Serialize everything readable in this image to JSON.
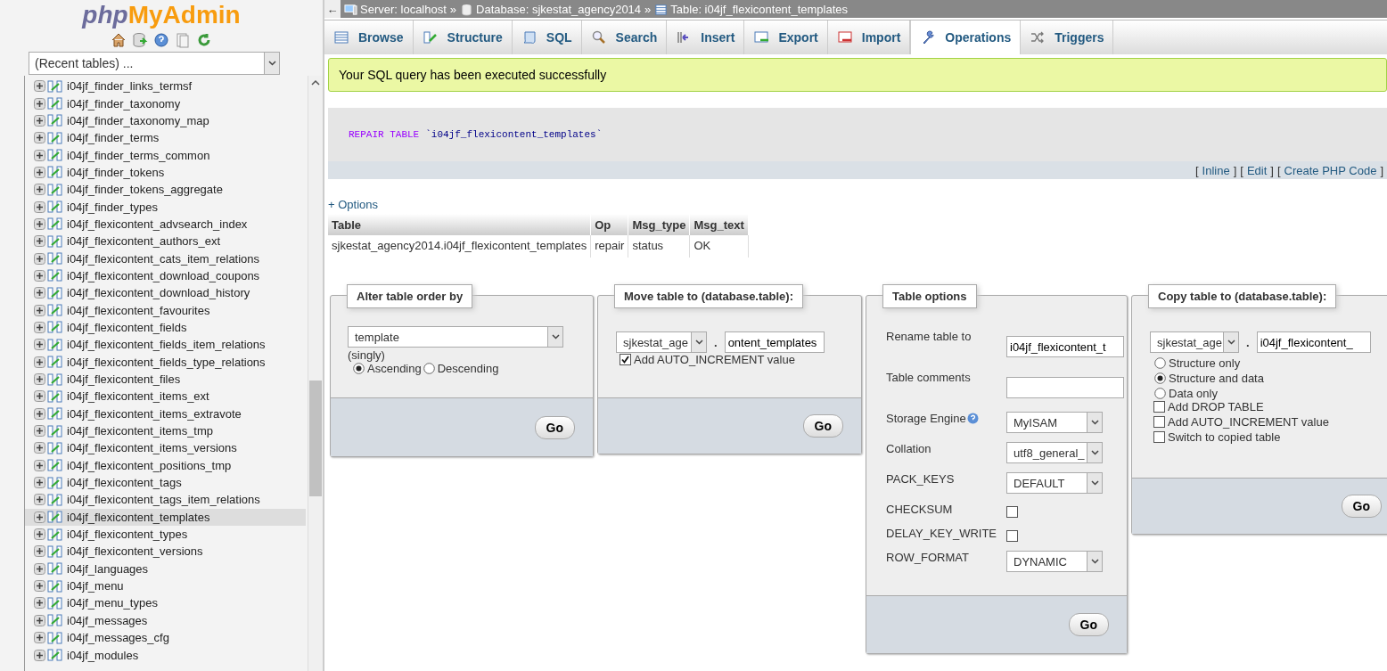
{
  "sidebar": {
    "logo": {
      "prefix": "php",
      "brand": "MyAdmin"
    },
    "recent_select": "(Recent tables) ...",
    "tables": [
      {
        "name": "i04jf_finder_links_termsf",
        "selected": false
      },
      {
        "name": "i04jf_finder_taxonomy",
        "selected": false
      },
      {
        "name": "i04jf_finder_taxonomy_map",
        "selected": false
      },
      {
        "name": "i04jf_finder_terms",
        "selected": false
      },
      {
        "name": "i04jf_finder_terms_common",
        "selected": false
      },
      {
        "name": "i04jf_finder_tokens",
        "selected": false
      },
      {
        "name": "i04jf_finder_tokens_aggregate",
        "selected": false
      },
      {
        "name": "i04jf_finder_types",
        "selected": false
      },
      {
        "name": "i04jf_flexicontent_advsearch_index",
        "selected": false
      },
      {
        "name": "i04jf_flexicontent_authors_ext",
        "selected": false
      },
      {
        "name": "i04jf_flexicontent_cats_item_relations",
        "selected": false
      },
      {
        "name": "i04jf_flexicontent_download_coupons",
        "selected": false
      },
      {
        "name": "i04jf_flexicontent_download_history",
        "selected": false
      },
      {
        "name": "i04jf_flexicontent_favourites",
        "selected": false
      },
      {
        "name": "i04jf_flexicontent_fields",
        "selected": false
      },
      {
        "name": "i04jf_flexicontent_fields_item_relations",
        "selected": false
      },
      {
        "name": "i04jf_flexicontent_fields_type_relations",
        "selected": false
      },
      {
        "name": "i04jf_flexicontent_files",
        "selected": false
      },
      {
        "name": "i04jf_flexicontent_items_ext",
        "selected": false
      },
      {
        "name": "i04jf_flexicontent_items_extravote",
        "selected": false
      },
      {
        "name": "i04jf_flexicontent_items_tmp",
        "selected": false
      },
      {
        "name": "i04jf_flexicontent_items_versions",
        "selected": false
      },
      {
        "name": "i04jf_flexicontent_positions_tmp",
        "selected": false
      },
      {
        "name": "i04jf_flexicontent_tags",
        "selected": false
      },
      {
        "name": "i04jf_flexicontent_tags_item_relations",
        "selected": false
      },
      {
        "name": "i04jf_flexicontent_templates",
        "selected": true
      },
      {
        "name": "i04jf_flexicontent_types",
        "selected": false
      },
      {
        "name": "i04jf_flexicontent_versions",
        "selected": false
      },
      {
        "name": "i04jf_languages",
        "selected": false
      },
      {
        "name": "i04jf_menu",
        "selected": false
      },
      {
        "name": "i04jf_menu_types",
        "selected": false
      },
      {
        "name": "i04jf_messages",
        "selected": false
      },
      {
        "name": "i04jf_messages_cfg",
        "selected": false
      },
      {
        "name": "i04jf_modules",
        "selected": false
      }
    ]
  },
  "breadcrumb": {
    "back": "←",
    "items": [
      {
        "kind": "server",
        "text": "Server: localhost",
        "separator": "»"
      },
      {
        "kind": "database",
        "text": "Database: sjkestat_agency2014",
        "separator": "»"
      },
      {
        "kind": "table",
        "text": "Table: i04jf_flexicontent_templates"
      }
    ]
  },
  "tabs": [
    {
      "label": "Browse",
      "selected": false
    },
    {
      "label": "Structure",
      "selected": false
    },
    {
      "label": "SQL",
      "selected": false
    },
    {
      "label": "Search",
      "selected": false
    },
    {
      "label": "Insert",
      "selected": false
    },
    {
      "label": "Export",
      "selected": false
    },
    {
      "label": "Import",
      "selected": false
    },
    {
      "label": "Operations",
      "selected": true
    },
    {
      "label": "Triggers",
      "selected": false
    }
  ],
  "message": "Your SQL query has been executed successfully",
  "sql": {
    "keyword": "REPAIR TABLE",
    "identifier": "`i04jf_flexicontent_templates`",
    "link_open": "[",
    "link_close": "]",
    "links": [
      "Inline",
      "Edit",
      "Create PHP Code"
    ]
  },
  "options_toggle": "+ Options",
  "result_table": {
    "columns": [
      "Table",
      "Op",
      "Msg_type",
      "Msg_text"
    ],
    "rows": [
      [
        "sjkestat_agency2014.i04jf_flexicontent_templates",
        "repair",
        "status",
        "OK"
      ]
    ]
  },
  "panels": [
    {
      "kind": "order",
      "legend": "Alter table order by",
      "select": "template",
      "note": "(singly)",
      "radios": [
        {
          "label": "Ascending",
          "selected": true
        },
        {
          "label": "Descending",
          "selected": false
        }
      ],
      "button": "Go"
    },
    {
      "kind": "move",
      "legend": "Move table to (database.table):",
      "db_select": "sjkestat_age",
      "dot": ".",
      "table_input": "ontent_templates",
      "checkboxes": [
        {
          "label": "Add AUTO_INCREMENT value",
          "checked": true
        }
      ],
      "button": "Go"
    },
    {
      "kind": "options",
      "legend": "Table options",
      "rows": [
        {
          "kind": "input",
          "label": "Rename table to",
          "value": "i04jf_flexicontent_t"
        },
        {
          "kind": "input",
          "label": "Table comments"
        },
        {
          "kind": "select",
          "label": "Storage Engine",
          "value": "MyISAM",
          "help": true
        },
        {
          "kind": "select",
          "label": "Collation",
          "value": "utf8_general_"
        },
        {
          "kind": "select",
          "label": "PACK_KEYS",
          "value": "DEFAULT"
        },
        {
          "kind": "checkbox",
          "label": "CHECKSUM",
          "checked": false
        },
        {
          "kind": "checkbox",
          "label": "DELAY_KEY_WRITE",
          "checked": false
        },
        {
          "kind": "select",
          "label": "ROW_FORMAT",
          "value": "DYNAMIC"
        }
      ],
      "button": "Go"
    },
    {
      "kind": "copy",
      "legend": "Copy table to (database.table):",
      "db_select": "sjkestat_age",
      "dot": ".",
      "table_input": "i04jf_flexicontent_",
      "radios": [
        {
          "label": "Structure only",
          "selected": false
        },
        {
          "label": "Structure and data",
          "selected": true
        },
        {
          "label": "Data only",
          "selected": false
        }
      ],
      "checkboxes": [
        {
          "label": "Add DROP TABLE",
          "checked": false
        },
        {
          "label": "Add AUTO_INCREMENT value",
          "checked": false
        },
        {
          "label": "Switch to copied table",
          "checked": false
        }
      ],
      "button": "Go"
    }
  ]
}
